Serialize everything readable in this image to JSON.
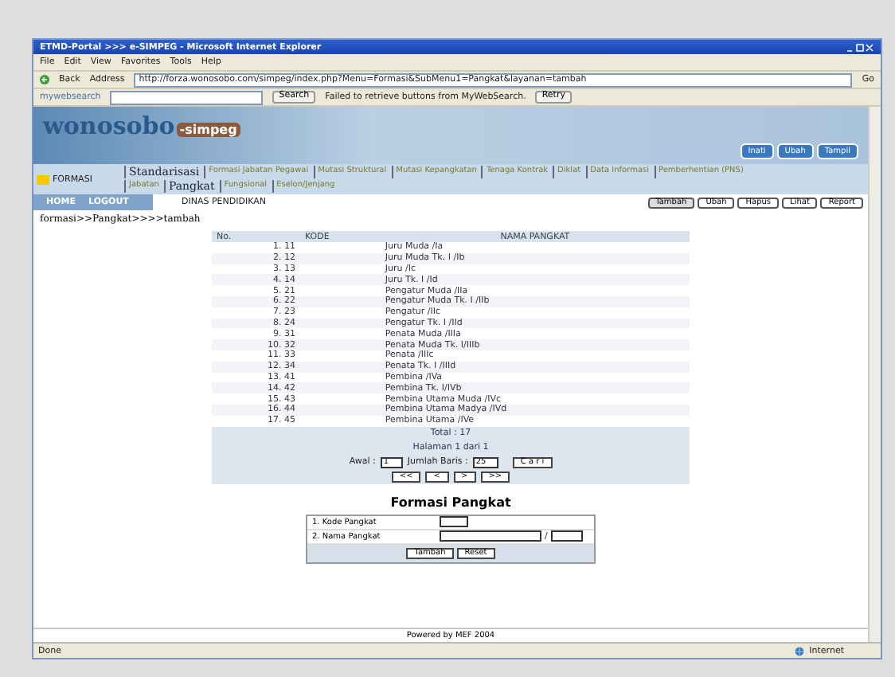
{
  "window": {
    "title": "ETMD-Portal >>> e-SIMPEG - Microsoft Internet Explorer"
  },
  "menu": [
    "File",
    "Edit",
    "View",
    "Favorites",
    "Tools",
    "Help"
  ],
  "address_bar": {
    "back": "Back",
    "label": "Address",
    "url": "http://forza.wonosobo.com/simpeg/index.php?Menu=Formasi&SubMenu1=Pangkat&layanan=tambah",
    "go": "Go"
  },
  "search_bar": {
    "brand": "mywebsearch",
    "search": "Search",
    "message": "Failed to retrieve buttons from MyWebSearch.",
    "retry": "Retry"
  },
  "banner": {
    "logo": "wonosobo",
    "logo_suffix": "-simpeg",
    "buttons": [
      "Inati",
      "Ubah",
      "Tampil"
    ]
  },
  "section_label": "FORMASI",
  "nav_top": [
    {
      "label": "Standarisasi",
      "selected": true
    },
    {
      "label": "Formasi Jabatan Pegawai",
      "selected": false
    },
    {
      "label": "Mutasi Struktural",
      "selected": false
    },
    {
      "label": "Mutasi Kepangkatan",
      "selected": false
    },
    {
      "label": "Tenaga Kontrak",
      "selected": false
    },
    {
      "label": "Diklat",
      "selected": false
    },
    {
      "label": "Data Informasi",
      "selected": false
    },
    {
      "label": "Pemberhentian (PNS)",
      "selected": false
    }
  ],
  "nav_sub": [
    {
      "label": "Jabatan",
      "selected": false
    },
    {
      "label": "Pangkat",
      "selected": true
    },
    {
      "label": "Fungsional",
      "selected": false
    },
    {
      "label": "Eselon/Jenjang",
      "selected": false
    }
  ],
  "home": "HOME",
  "logout": "LOGOUT",
  "unit": "DINAS PENDIDIKAN",
  "actions": [
    {
      "label": "Tambah",
      "selected": true
    },
    {
      "label": "Ubah",
      "selected": false
    },
    {
      "label": "Hapus",
      "selected": false
    },
    {
      "label": "Lihat",
      "selected": false
    },
    {
      "label": "Report",
      "selected": false
    }
  ],
  "breadcrumb": "formasi>>Pangkat>>>>tambah",
  "table": {
    "columns": [
      "No.",
      "KODE",
      "NAMA PANGKAT"
    ],
    "rows": [
      [
        "1. 11",
        "Juru Muda /Ia"
      ],
      [
        "2. 12",
        "Juru Muda Tk. I /Ib"
      ],
      [
        "3. 13",
        "Juru /Ic"
      ],
      [
        "4. 14",
        "Juru Tk. I /Id"
      ],
      [
        "5. 21",
        "Pengatur Muda /IIa"
      ],
      [
        "6. 22",
        "Pengatur Muda Tk. I /IIb"
      ],
      [
        "7. 23",
        "Pengatur /IIc"
      ],
      [
        "8. 24",
        "Pengatur Tk. I /IId"
      ],
      [
        "9. 31",
        "Penata Muda /IIIa"
      ],
      [
        "10. 32",
        "Penata Muda Tk. I/IIIb"
      ],
      [
        "11. 33",
        "Penata /IIIc"
      ],
      [
        "12. 34",
        "Penata Tk. I /IIId"
      ],
      [
        "13. 41",
        "Pembina /IVa"
      ],
      [
        "14. 42",
        "Pembina Tk. I/IVb"
      ],
      [
        "15. 43",
        "Pembina Utama Muda /IVc"
      ],
      [
        "16. 44",
        "Pembina Utama Madya /IVd"
      ],
      [
        "17. 45",
        "Pembina Utama /IVe"
      ]
    ],
    "total": "Total : 17",
    "page": "Halaman 1 dari 1",
    "start_label": "Awal :",
    "start_value": "1",
    "rows_label": "Jumlah Baris :",
    "rows_value": "25",
    "find": "C a r i",
    "pager": [
      "<<",
      "<",
      ">",
      ">>"
    ]
  },
  "form": {
    "title": "Formasi Pangkat",
    "fields": [
      {
        "label": "1. Kode Pangkat",
        "kind": "short"
      },
      {
        "label": "2. Nama Pangkat",
        "kind": "pair",
        "separator": "/"
      }
    ],
    "buttons": [
      "Tambah",
      "Reset"
    ]
  },
  "footer": "Powered by MEF 2004",
  "status_bar": {
    "text": "Done",
    "zone": "Internet"
  }
}
